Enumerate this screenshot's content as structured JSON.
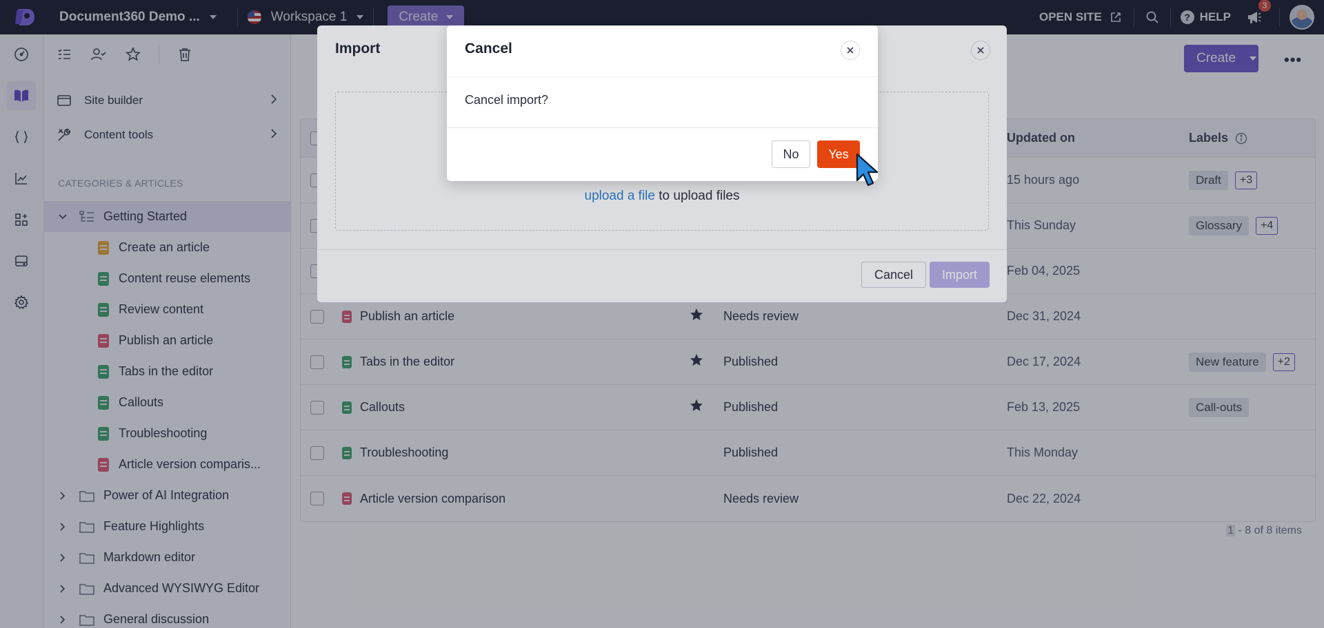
{
  "topbar": {
    "project_name": "Document360 Demo ...",
    "workspace": "Workspace 1",
    "create_label": "Create",
    "open_site_label": "OPEN SITE",
    "help_label": "HELP",
    "notification_count": "3"
  },
  "sidebar": {
    "tools": [
      "list-icon",
      "user-check-icon",
      "star-icon",
      "trash-icon"
    ],
    "site_builder": "Site builder",
    "content_tools": "Content tools",
    "section_heading": "CATEGORIES & ARTICLES",
    "tree": {
      "selected_category": "Getting Started",
      "articles": [
        {
          "title": "Create an article",
          "color": "orange"
        },
        {
          "title": "Content reuse elements",
          "color": "green"
        },
        {
          "title": "Review content",
          "color": "green"
        },
        {
          "title": "Publish an article",
          "color": "red"
        },
        {
          "title": "Tabs in the editor",
          "color": "green"
        },
        {
          "title": "Callouts",
          "color": "green"
        },
        {
          "title": "Troubleshooting",
          "color": "green"
        },
        {
          "title": "Article version comparis...",
          "color": "red"
        }
      ],
      "categories": [
        "Power of AI Integration",
        "Feature Highlights",
        "Markdown editor",
        "Advanced WYSIWYG Editor",
        "General discussion"
      ]
    }
  },
  "main": {
    "create_label": "Create",
    "more_label": "•••",
    "columns": {
      "updated_on": "Updated on",
      "labels": "Labels"
    },
    "rows": [
      {
        "title": "",
        "color": "",
        "starred": false,
        "status": "",
        "updated": "15 hours ago",
        "labels": [
          "Draft"
        ],
        "more": "+3"
      },
      {
        "title": "",
        "color": "",
        "starred": false,
        "status": "",
        "updated": "This Sunday",
        "labels": [
          "Glossary"
        ],
        "more": "+4"
      },
      {
        "title": "",
        "color": "",
        "starred": false,
        "status": "",
        "updated": "Feb 04, 2025",
        "labels": [],
        "more": ""
      },
      {
        "title": "Publish an article",
        "color": "red",
        "starred": true,
        "status": "Needs review",
        "updated": "Dec 31, 2024",
        "labels": [],
        "more": ""
      },
      {
        "title": "Tabs in the editor",
        "color": "green",
        "starred": true,
        "status": "Published",
        "updated": "Dec 17, 2024",
        "labels": [
          "New feature"
        ],
        "more": "+2"
      },
      {
        "title": "Callouts",
        "color": "green",
        "starred": true,
        "status": "Published",
        "updated": "Feb 13, 2025",
        "labels": [
          "Call-outs"
        ],
        "more": ""
      },
      {
        "title": "Troubleshooting",
        "color": "green",
        "starred": false,
        "status": "Published",
        "updated": "This Monday",
        "labels": [],
        "more": ""
      },
      {
        "title": "Article version comparison",
        "color": "red",
        "starred": false,
        "status": "Needs review",
        "updated": "Dec 22, 2024",
        "labels": [],
        "more": ""
      }
    ],
    "pager_first": "1",
    "pager_rest": " - 8 of 8 items"
  },
  "import_modal": {
    "title": "Import",
    "upload_link": "upload a file",
    "upload_suffix": " to upload files",
    "cancel_label": "Cancel",
    "import_label": "Import"
  },
  "confirm_modal": {
    "title": "Cancel",
    "message": "Cancel import?",
    "no_label": "No",
    "yes_label": "Yes"
  },
  "colors": {
    "brand_purple": "#6c57c9",
    "yes_orange": "#e5460f",
    "topbar_bg": "#121625"
  }
}
